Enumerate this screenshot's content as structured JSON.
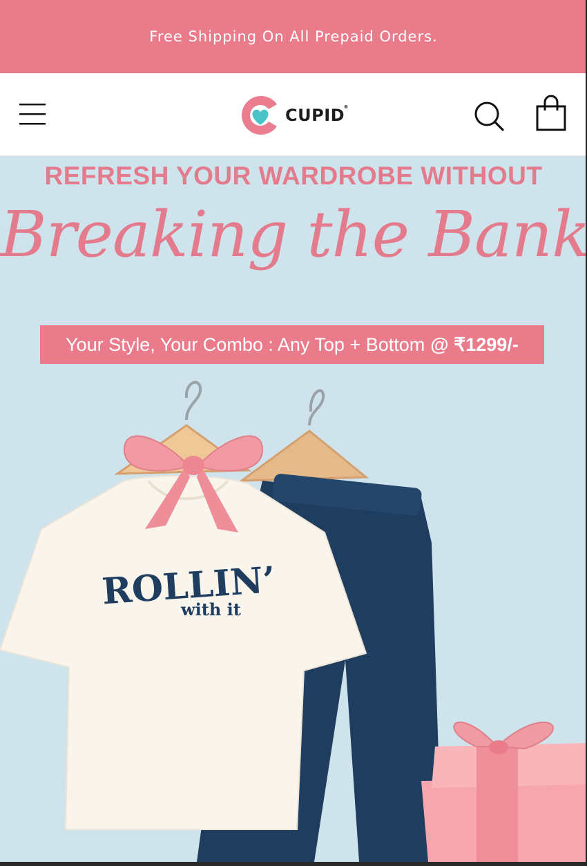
{
  "announcement": {
    "text": "Free Shipping On All Prepaid Orders."
  },
  "header": {
    "logo_text": "CUPID",
    "logo_mark": "®",
    "icons": {
      "menu": "hamburger-menu-icon",
      "search": "search-icon",
      "cart": "shopping-bag-icon"
    }
  },
  "banner": {
    "headline": "REFRESH YOUR WARDROBE WITHOUT",
    "script_title": "Breaking the Bank",
    "combo_text": "Your Style, Your Combo : Any Top + Bottom",
    "combo_price": "@ ₹1299/-",
    "tshirt_print_line1": "ROLLIN’",
    "tshirt_print_line2": "with it"
  },
  "colors": {
    "accent_pink": "#e97b8b",
    "banner_bg": "#cfe3ed",
    "navy": "#1f3d5f",
    "logo_teal": "#49c3c7"
  }
}
